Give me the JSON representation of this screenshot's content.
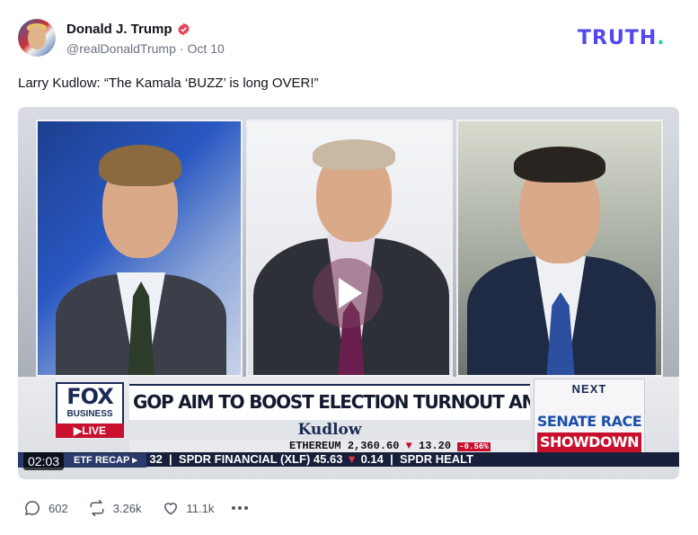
{
  "author": {
    "display_name": "Donald J. Trump",
    "handle": "@realDonaldTrump",
    "separator": "·",
    "date": "Oct 10",
    "verified": true
  },
  "brand": {
    "name": "TRUTH",
    "dot": "."
  },
  "post": {
    "text": "Larry Kudlow: “The Kamala ‘BUZZ’ is long OVER!”"
  },
  "video": {
    "duration": "02:03",
    "lower_third": {
      "network": "FOX",
      "network_sub": "BUSINESS",
      "live": "LIVE",
      "headline": "GOP AIM TO BOOST ELECTION TURNOUT AMONG GUN OWNERS",
      "show": "Kudlow",
      "next_label": "NEXT",
      "next_line1": "SENATE RACE",
      "next_line2": "SHOWDOWN",
      "ticker_top": {
        "symbol": "ETHEREUM",
        "price": "2,360.60",
        "change": "13.20",
        "pct": "-0.56%"
      },
      "ticker": {
        "recap": "ETF RECAP",
        "fragment": "32",
        "item1": "SPDR FINANCIAL (XLF)",
        "item1_price": "45.63",
        "item1_change": "0.14",
        "item2": "SPDR HEALT"
      }
    }
  },
  "actions": {
    "replies": "602",
    "retruths": "3.26k",
    "likes": "11.1k"
  },
  "colors": {
    "brand": "#5448ee",
    "brand_dot": "#1dd3a7",
    "verified": "#e0445a",
    "fox_red": "#c8102e",
    "fox_navy": "#1b2a55"
  },
  "icons": [
    "verified-badge-icon",
    "play-icon",
    "reply-icon",
    "retruth-icon",
    "like-icon",
    "more-icon"
  ]
}
